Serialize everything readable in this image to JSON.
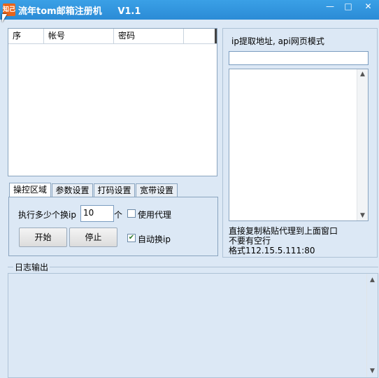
{
  "window": {
    "app_icon_text": "知己",
    "title": "流年tom邮箱注册机     V1.1",
    "min_glyph": "—",
    "max_glyph": "□",
    "close_glyph": "✕"
  },
  "listview": {
    "columns": [
      "序",
      "帐号",
      "密码"
    ]
  },
  "tabs": [
    "操控区域",
    "参数设置",
    "打码设置",
    "宽带设置"
  ],
  "controls": {
    "per_ip_label": "执行多少个换ip",
    "per_ip_value": "10",
    "per_ip_unit": "个",
    "use_proxy_label": "使用代理",
    "use_proxy_checked": false,
    "start_button": "开始",
    "stop_button": "停止",
    "auto_switch_label": "自动换ip",
    "auto_switch_checked": true,
    "check_mark": "✔"
  },
  "right_panel": {
    "heading": "ip提取地址, api网页模式",
    "url_value": "",
    "hint_line1": "直接复制粘贴代理到上面窗口",
    "hint_line2": "不要有空行",
    "hint_line3": "格式112.15.5.111:80"
  },
  "log": {
    "legend": "日志输出"
  },
  "colors": {
    "titlebar": "#2b8bd6",
    "background": "#dce8f5",
    "checkbox_tick": "#2a7a2a"
  }
}
